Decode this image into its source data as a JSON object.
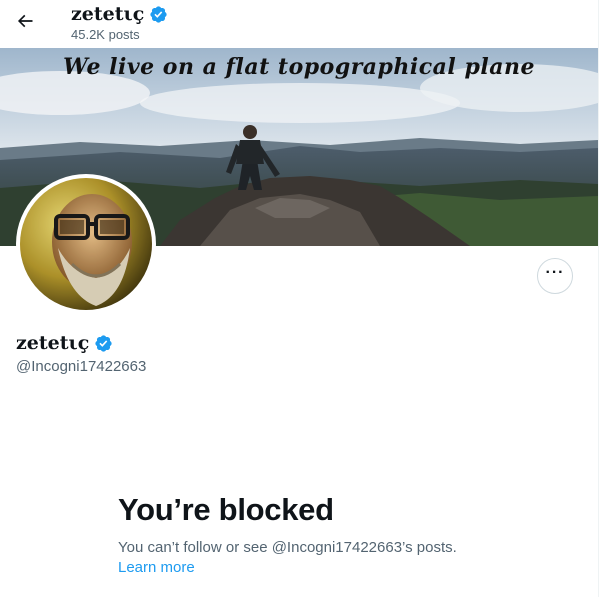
{
  "header": {
    "name": "zetetιç",
    "posts_count": "45.2K posts"
  },
  "banner": {
    "caption": "We live on a flat topographical plane"
  },
  "profile": {
    "display_name": "zetetιç",
    "handle": "@Incogni17422663",
    "more_label": "···"
  },
  "blocked": {
    "title": "You’re blocked",
    "message": "You can’t follow or see @Incogni17422663’s posts.",
    "learn_more": "Learn more"
  },
  "colors": {
    "accent": "#1d9bf0",
    "text_primary": "#0f1419",
    "text_secondary": "#536471",
    "border": "#cfd9de"
  },
  "icons": {
    "back": "arrow-left-icon",
    "verified": "verified-badge-icon",
    "more": "ellipsis-icon"
  }
}
